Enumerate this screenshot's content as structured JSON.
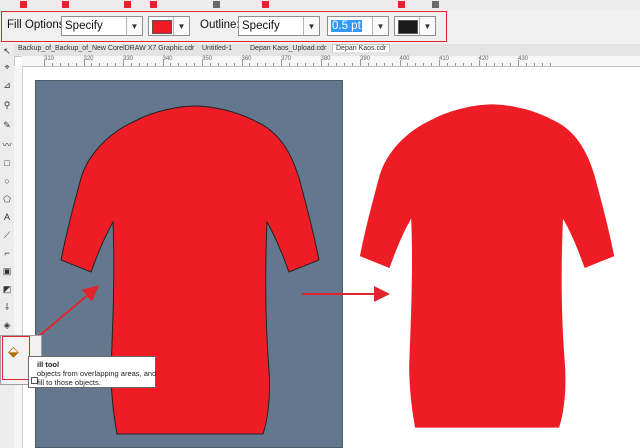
{
  "property_bar": {
    "fill_label": "Fill Options:",
    "fill_mode": "Specify",
    "fill_color": "#ee1c25",
    "outline_label": "Outline:",
    "outline_mode": "Specify",
    "outline_width": "0.5 pt",
    "outline_color": "#1a1a1a"
  },
  "tabs": [
    {
      "label": "Backup_of_Backup_of_New CorelDRAW X7 Graphic.cdr"
    },
    {
      "label": "Untitled-1"
    },
    {
      "label": "Depan Kaos_Upload.cdr"
    },
    {
      "label": "Depan Kaos.cdr"
    }
  ],
  "ruler": {
    "ticks": [
      "310",
      "320",
      "330",
      "340",
      "350",
      "360",
      "370",
      "380",
      "390",
      "400",
      "410",
      "420",
      "430"
    ]
  },
  "tooltip": {
    "title": "ill tool",
    "line1": "objects from overlapping areas, and",
    "line2": "fill to those objects."
  },
  "colors": {
    "accent": "#e0262c",
    "page": "#63788e",
    "shirt": "#ee1c25"
  },
  "icons": {
    "tools": [
      "pick-tool-icon",
      "shape-tool-icon",
      "crop-tool-icon",
      "zoom-tool-icon",
      "freehand-tool-icon",
      "artistic-media-icon",
      "rectangle-tool-icon",
      "ellipse-tool-icon",
      "polygon-tool-icon",
      "text-tool-icon",
      "parallel-dimension-icon",
      "connector-tool-icon",
      "drop-shadow-icon",
      "transparency-tool-icon",
      "eyedropper-tool-icon",
      "interactive-fill-icon",
      "smart-fill-icon"
    ]
  }
}
